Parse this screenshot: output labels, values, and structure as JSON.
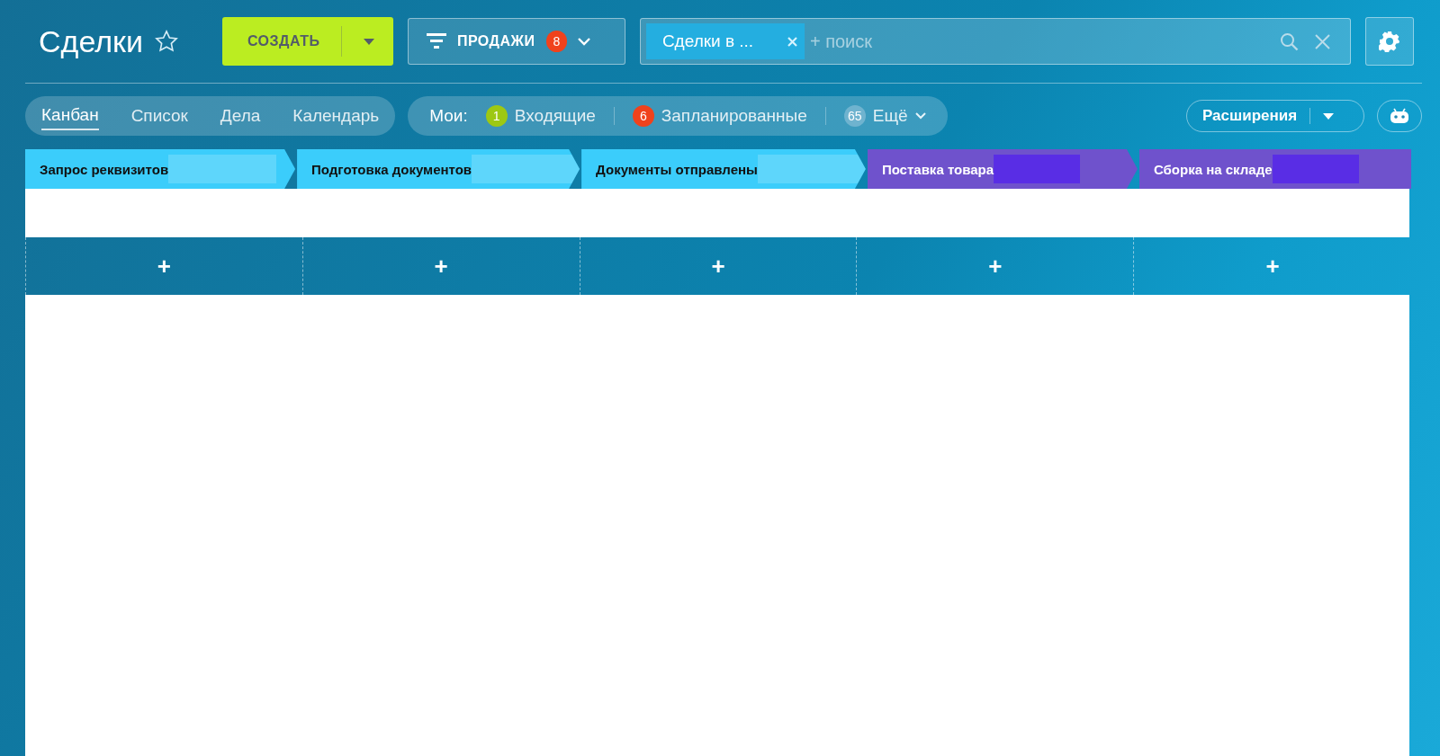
{
  "title": "Сделки",
  "favorite": false,
  "create_button": {
    "label": "СОЗДАТЬ"
  },
  "pipeline": {
    "label": "ПРОДАЖИ",
    "count": "8"
  },
  "search": {
    "chip": "Сделки в ...",
    "placeholder": "+ поиск"
  },
  "views": [
    {
      "label": "Канбан",
      "selected": true
    },
    {
      "label": "Список",
      "selected": false
    },
    {
      "label": "Дела",
      "selected": false
    },
    {
      "label": "Календарь",
      "selected": false
    }
  ],
  "my": {
    "label": "Мои:",
    "counters": [
      {
        "count": "1",
        "label": "Входящие",
        "color": "#9dc813"
      },
      {
        "count": "6",
        "label": "Запланированные",
        "color": "#f0421c"
      },
      {
        "count": "65",
        "label": "Ещё",
        "color": "#6fb3cf"
      }
    ]
  },
  "extensions_button": {
    "label": "Расширения"
  },
  "stages": [
    {
      "name": "Запрос реквизитов",
      "color": "#3bcdfb"
    },
    {
      "name": "Подготовка документов",
      "color": "#3bcdfb"
    },
    {
      "name": "Документы отправлены",
      "color": "#3bcdfb"
    },
    {
      "name": "Поставка товара",
      "color": "#6f52cc"
    },
    {
      "name": "Сборка на складе",
      "color": "#6f52cc"
    }
  ],
  "add_symbol": "+"
}
